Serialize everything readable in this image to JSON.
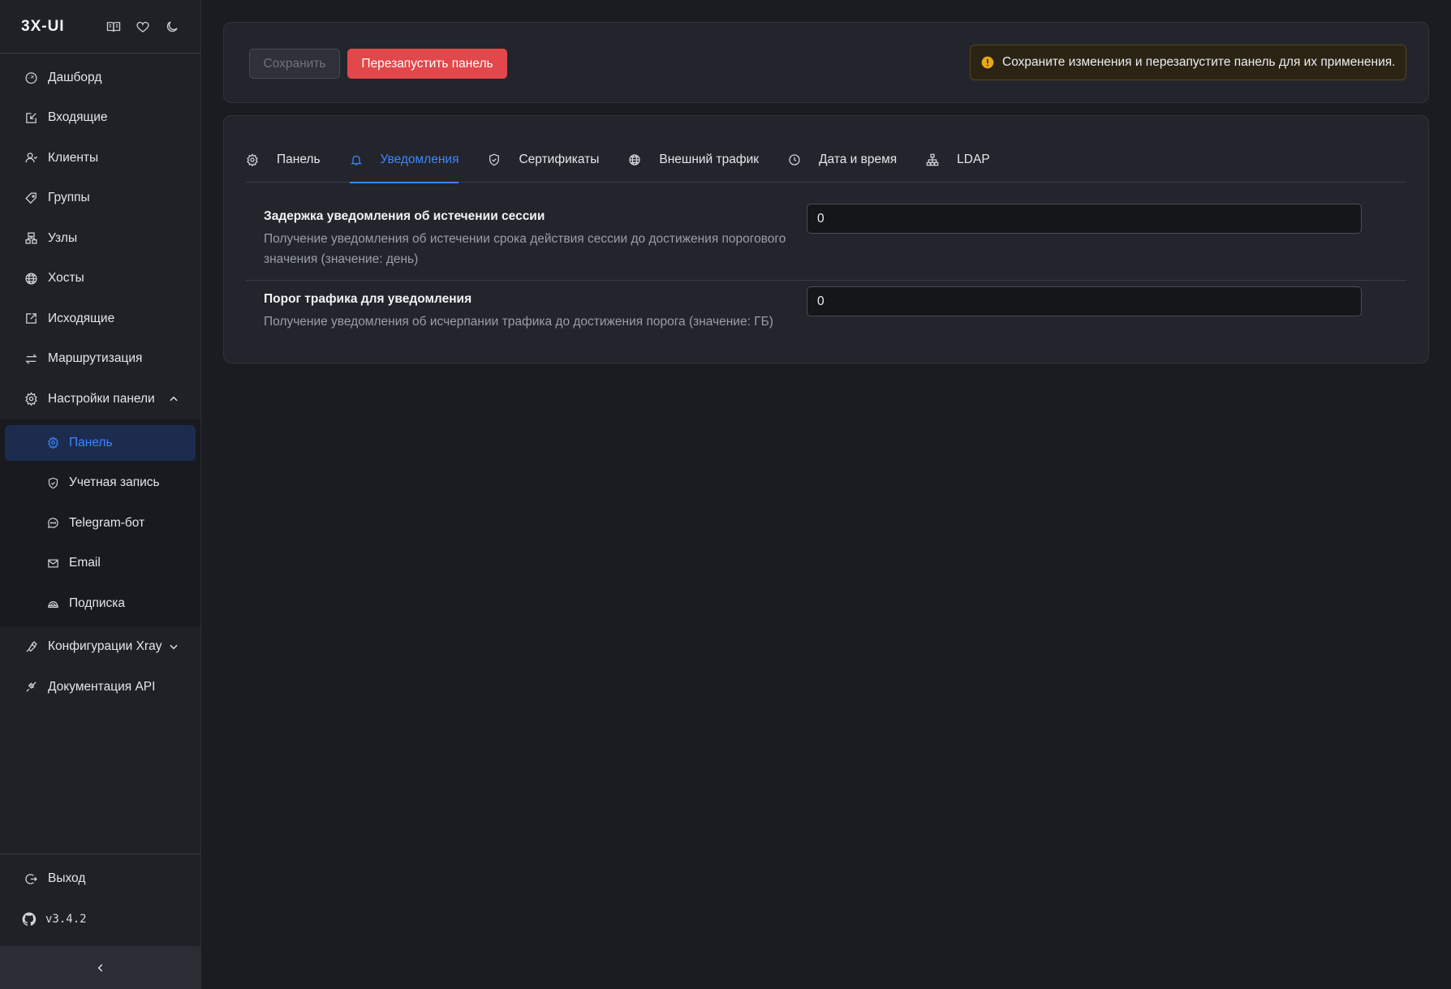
{
  "app": {
    "brand": "3X-UI",
    "version": "v3.4.2"
  },
  "sidebar": {
    "items": [
      {
        "label": "Дашборд",
        "icon": "dashboard-icon"
      },
      {
        "label": "Входящие",
        "icon": "inbound-icon"
      },
      {
        "label": "Клиенты",
        "icon": "clients-icon"
      },
      {
        "label": "Группы",
        "icon": "groups-icon"
      },
      {
        "label": "Узлы",
        "icon": "nodes-icon"
      },
      {
        "label": "Хосты",
        "icon": "globe-icon"
      },
      {
        "label": "Исходящие",
        "icon": "outbound-icon"
      },
      {
        "label": "Маршрутизация",
        "icon": "routing-icon"
      },
      {
        "label": "Настройки панели",
        "icon": "gear-icon",
        "expanded": true
      }
    ],
    "submenu": [
      {
        "label": "Панель",
        "icon": "gear-icon",
        "active": true
      },
      {
        "label": "Учетная запись",
        "icon": "shield-icon"
      },
      {
        "label": "Telegram-бот",
        "icon": "chat-icon"
      },
      {
        "label": "Email",
        "icon": "mail-icon"
      },
      {
        "label": "Подписка",
        "icon": "subscription-icon"
      }
    ],
    "after": [
      {
        "label": "Конфигурации Xray",
        "icon": "tool-icon",
        "expanded": false
      },
      {
        "label": "Документация API",
        "icon": "api-icon"
      }
    ],
    "logout": "Выход"
  },
  "toolbar": {
    "save_label": "Сохранить",
    "restart_label": "Перезапустить панель",
    "alert_text": "Сохраните изменения и перезапустите панель для их применения."
  },
  "tabs": [
    {
      "label": "Панель",
      "icon": "gear-icon"
    },
    {
      "label": "Уведомления",
      "icon": "bell-icon",
      "active": true
    },
    {
      "label": "Сертификаты",
      "icon": "shield-icon"
    },
    {
      "label": "Внешний трафик",
      "icon": "globe-icon"
    },
    {
      "label": "Дата и время",
      "icon": "clock-icon"
    },
    {
      "label": "LDAP",
      "icon": "ldap-icon"
    }
  ],
  "settings": [
    {
      "title": "Задержка уведомления об истечении сессии",
      "desc": "Получение уведомления об истечении срока действия сессии до достижения порогового значения (значение: день)",
      "value": "0"
    },
    {
      "title": "Порог трафика для уведомления",
      "desc": "Получение уведомления об исчерпании трафика до достижения порога (значение: ГБ)",
      "value": "0"
    }
  ],
  "colors": {
    "accent": "#3d86ff",
    "danger": "#e2474b",
    "warning": "#e6a817",
    "background": "#1a1c22",
    "sidebar": "#1f2127"
  }
}
